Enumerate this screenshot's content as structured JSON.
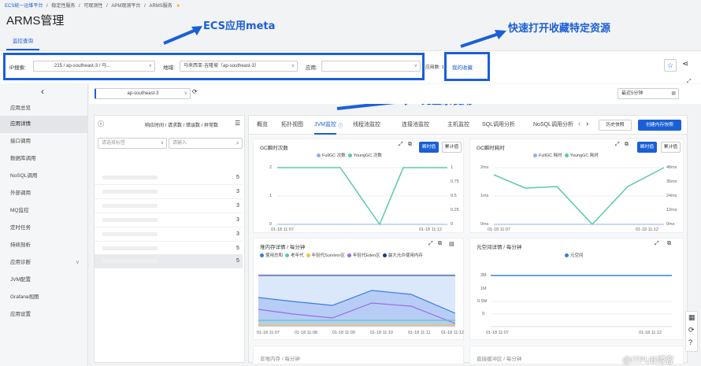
{
  "breadcrumb": [
    "ECS统一运维平台",
    "/",
    "稳定性服务",
    "/",
    "可观测性",
    "/",
    "APM观测平台",
    "/",
    "ARMS服务",
    "★"
  ],
  "page_title": "ARMS管理",
  "function_tab": "监控查询",
  "filters": {
    "ip_label": "IP搜索:",
    "ip_value": "215 / ap-southeast-3 / 马...",
    "region_label": "地域:",
    "region_value": "马来西亚-吉隆坡（ap-southeast-3）",
    "app_label": "应用:",
    "app_value": "",
    "app_count_label": "应用数: 1",
    "favorites_link": "我的收藏"
  },
  "annotations": {
    "ecs_meta": "ECS应用meta",
    "favorites": "快速打开收藏特定资源",
    "no_login": "免登录使用"
  },
  "sidebar": {
    "items": [
      {
        "label": "应用总览"
      },
      {
        "label": "应用详情"
      },
      {
        "label": "接口调用"
      },
      {
        "label": "数据库调用"
      },
      {
        "label": "NoSQL调用"
      },
      {
        "label": "外部调用"
      },
      {
        "label": "MQ监控"
      },
      {
        "label": "定时任务"
      },
      {
        "label": "持续剖析"
      },
      {
        "label": "应用诊断"
      },
      {
        "label": "JVM配置"
      },
      {
        "label": "Grafana视图"
      },
      {
        "label": "应用设置"
      }
    ]
  },
  "region_select": "ap-southeast-3",
  "time_range": "最近5分钟",
  "list_panel": {
    "header": "响应时间 / 请求数 / 错误数 / 异常数",
    "tag_placeholder": "请选择标签",
    "search_placeholder": "请输入",
    "row_values": [
      "5",
      "3",
      "3",
      "3",
      "3",
      "5",
      "5"
    ]
  },
  "detail_tabs": [
    "概览",
    "拓扑视图",
    "JVM监控",
    "线程池监控",
    "连接池监控",
    "主机监控",
    "SQL调用分析",
    "NoSQL调用分析"
  ],
  "actions": {
    "history": "历史快照",
    "create_snapshot": "创建内存快照"
  },
  "charts": {
    "gc_count": {
      "title": "GC瞬时次数",
      "legend": [
        "FullGC 次数",
        "YoungGC 次数"
      ],
      "btn_instant": "瞬时值",
      "btn_cumulative": "累计值"
    },
    "gc_time": {
      "title": "GC瞬时耗时",
      "legend": [
        "FullGC 耗时",
        "YoungGC 耗时"
      ],
      "btn_instant": "瞬时值",
      "btn_cumulative": "累计值"
    },
    "heap": {
      "title": "堆内存详情 / 每分钟",
      "legend": [
        "使用总和",
        "老年代",
        "年轻代Survivor区",
        "年轻代Eden区",
        "最大允许使用内存"
      ]
    },
    "metaspace": {
      "title": "元空间详情 / 每分钟",
      "legend": [
        "元空间"
      ]
    },
    "nonheap": {
      "title": "非堆内存 / 每分钟"
    },
    "direct_buffer": {
      "title": "直接缓冲区 / 每分钟"
    }
  },
  "chart_data": [
    {
      "type": "line",
      "title": "GC瞬时次数",
      "x": [
        "01-18 11:07",
        "01-18 11:12"
      ],
      "series": [
        {
          "name": "FullGC 次数",
          "values": [
            0,
            0,
            0,
            0,
            0,
            0
          ]
        },
        {
          "name": "YoungGC 次数",
          "values": [
            2,
            2,
            2,
            0,
            2,
            2
          ]
        }
      ],
      "yleft": [
        "2",
        "1",
        "0"
      ],
      "yright": [
        "1",
        "0.75",
        "0.5",
        "0.25",
        "0"
      ]
    },
    {
      "type": "line",
      "title": "GC瞬时耗时",
      "x": [
        "01-18 11:07",
        "01-18 11:12"
      ],
      "series": [
        {
          "name": "FullGC 耗时",
          "values": [
            0,
            0,
            0,
            0,
            0,
            0
          ]
        },
        {
          "name": "YoungGC 耗时",
          "values": [
            40,
            30,
            31,
            0,
            29,
            47
          ]
        }
      ],
      "yleft": [
        "2ms",
        "1ms",
        "0ms"
      ],
      "yright": [
        "48ms",
        "36ms",
        "24ms",
        "12ms",
        "0ms"
      ]
    },
    {
      "type": "area",
      "title": "堆内存详情 / 每分钟",
      "x": [
        "01-18 11:07",
        "01-18 11:08",
        "01-18 11:09",
        "01-18 11:10",
        "01-18 11:11",
        "01-18 11:12"
      ],
      "series": [
        {
          "name": "使用总和",
          "values": [
            0.55,
            0.5,
            0.45,
            0.62,
            0.58,
            0.3
          ]
        },
        {
          "name": "老年代",
          "values": [
            0.15,
            0.15,
            0.15,
            0.15,
            0.15,
            0.15
          ]
        },
        {
          "name": "年轻代Survivor区",
          "values": [
            0.02,
            0.02,
            0.02,
            0.02,
            0.02,
            0.02
          ]
        },
        {
          "name": "年轻代Eden区",
          "values": [
            0.38,
            0.33,
            0.28,
            0.45,
            0.41,
            0.13
          ]
        },
        {
          "name": "最大允许使用内存",
          "values": [
            0.95,
            0.95,
            0.95,
            0.95,
            0.95,
            0.95
          ]
        }
      ]
    },
    {
      "type": "line",
      "title": "元空间详情 / 每分钟",
      "x": [
        "01-18 11:07",
        "01-18 11:12"
      ],
      "yticks": [
        "2M",
        "1M",
        "0.5M",
        "0"
      ],
      "series": [
        {
          "name": "元空间",
          "values": [
            2.0,
            2.0,
            2.0,
            2.0,
            2.0,
            2.0
          ]
        }
      ]
    }
  ],
  "watermark": "@ITPUB博客",
  "colors": {
    "accent": "#1a5fd6",
    "teal": "#5bc8ad",
    "annotation": "#1b5fd8"
  }
}
